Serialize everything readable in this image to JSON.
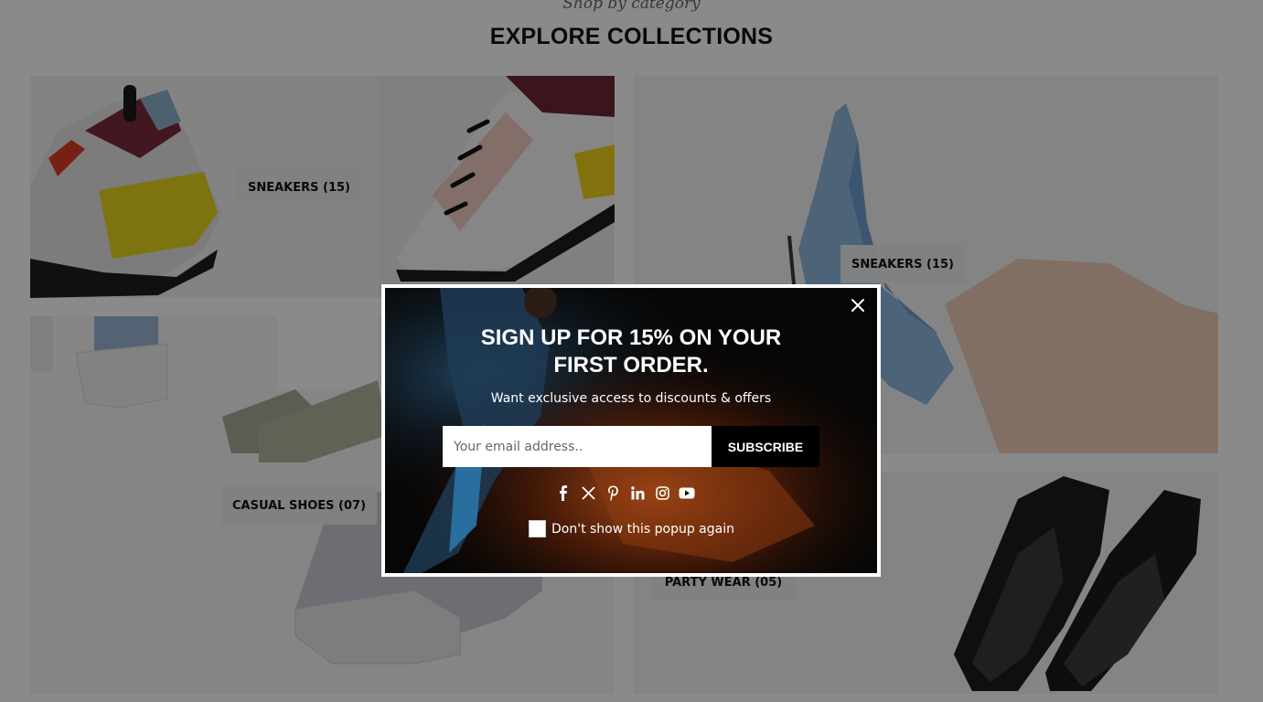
{
  "section": {
    "subtitle": "Shop by category",
    "title": "EXPLORE COLLECTIONS"
  },
  "collections": [
    {
      "label": "SNEAKERS (15)"
    },
    {
      "label": "SNEAKERS (15)"
    },
    {
      "label": "CASUAL SHOES (07)"
    },
    {
      "label": "PARTY WEAR (05)"
    }
  ],
  "popup": {
    "title": "SIGN UP FOR 15% ON YOUR FIRST ORDER.",
    "subtitle": "Want exclusive access to discounts & offers",
    "email_placeholder": "Your email address..",
    "email_value": "",
    "subscribe_label": "SUBSCRIBE",
    "dont_show_label": "Don't show this popup again",
    "dont_show_checked": false,
    "social_icons": [
      "facebook-icon",
      "x-icon",
      "pinterest-icon",
      "linkedin-icon",
      "instagram-icon",
      "youtube-icon"
    ]
  },
  "colors": {
    "overlay": "#000000",
    "popup_bg": "#060606",
    "popup_border": "#ffffff",
    "subscribe_bg": "#000000",
    "label_bg": "#eeeeee"
  }
}
